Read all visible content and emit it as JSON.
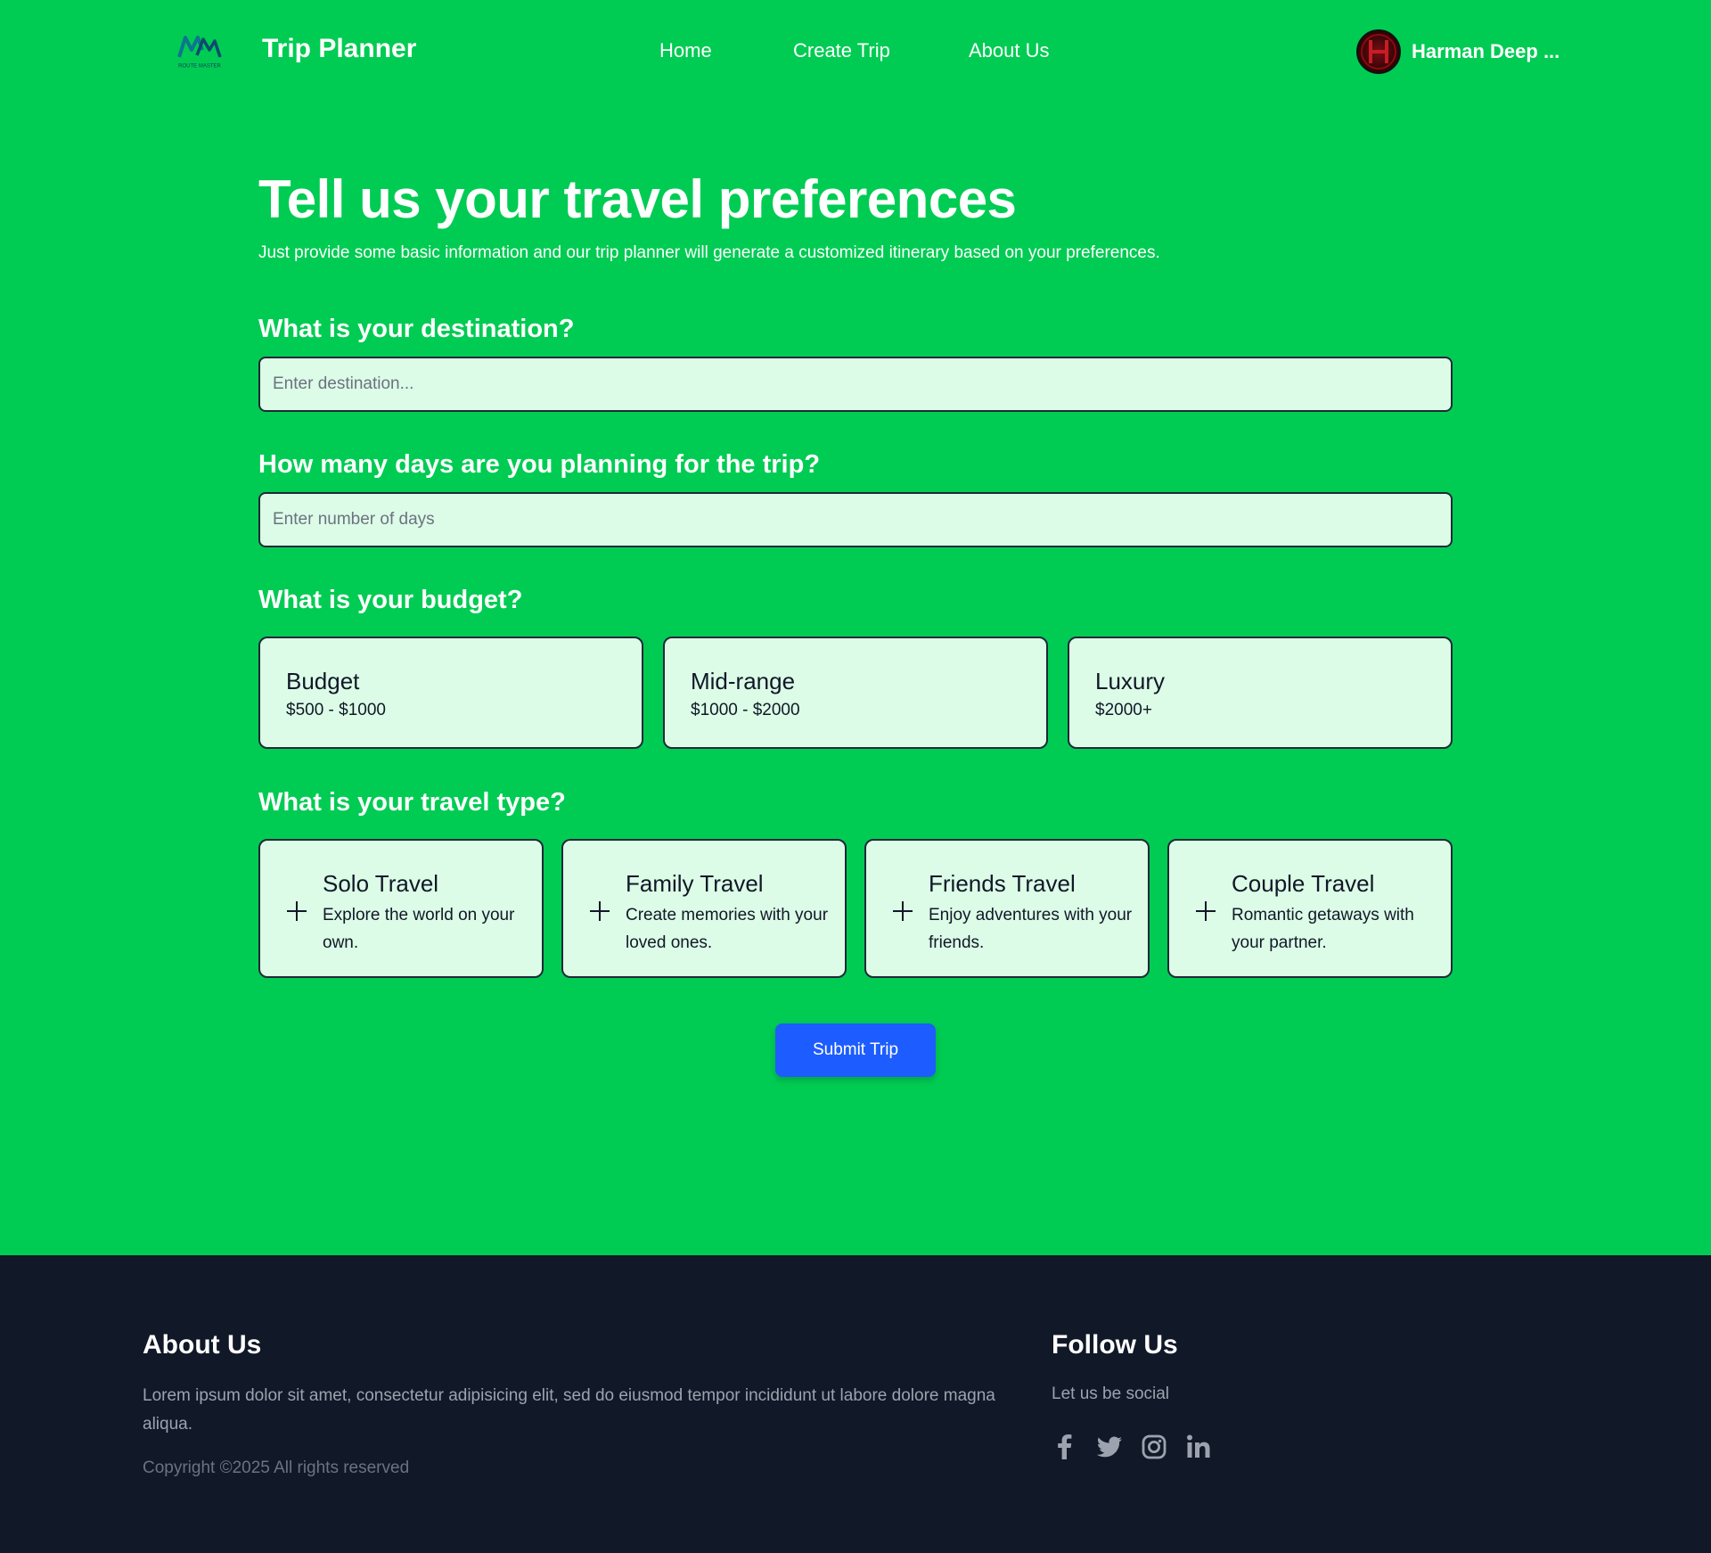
{
  "header": {
    "logo_text": "ROUTE MASTER",
    "brand": "Trip Planner",
    "nav": [
      "Home",
      "Create Trip",
      "About Us"
    ],
    "user_name": "Harman Deep ..."
  },
  "main": {
    "title": "Tell us your travel preferences",
    "subtitle": "Just provide some basic information and our trip planner will generate a customized itinerary based on your preferences.",
    "destination": {
      "question": "What is your destination?",
      "placeholder": "Enter destination..."
    },
    "days": {
      "question": "How many days are you planning for the trip?",
      "placeholder": "Enter number of days"
    },
    "budget": {
      "question": "What is your budget?",
      "options": [
        {
          "title": "Budget",
          "range": "$500 - $1000"
        },
        {
          "title": "Mid-range",
          "range": "$1000 - $2000"
        },
        {
          "title": "Luxury",
          "range": "$2000+"
        }
      ]
    },
    "travel_type": {
      "question": "What is your travel type?",
      "options": [
        {
          "title": "Solo Travel",
          "desc": "Explore the world on your own.",
          "icon": "plus-icon"
        },
        {
          "title": "Family Travel",
          "desc": "Create memories with your loved ones.",
          "icon": "plus-icon"
        },
        {
          "title": "Friends Travel",
          "desc": "Enjoy adventures with your friends.",
          "icon": "plus-icon"
        },
        {
          "title": "Couple Travel",
          "desc": "Romantic getaways with your partner.",
          "icon": "plus-icon"
        }
      ]
    },
    "submit_label": "Submit Trip"
  },
  "footer": {
    "about_heading": "About Us",
    "about_text": "Lorem ipsum dolor sit amet, consectetur adipisicing elit, sed do eiusmod tempor incididunt ut labore dolore magna aliqua.",
    "copyright": "Copyright ©2025 All rights reserved",
    "follow_heading": "Follow Us",
    "follow_text": "Let us be social",
    "social_icons": [
      "facebook-icon",
      "twitter-icon",
      "instagram-icon",
      "linkedin-icon"
    ]
  },
  "colors": {
    "page_background": "#00cc53",
    "card_background": "#dcfce7",
    "submit_button": "#1d5cff",
    "footer_background": "#111827"
  }
}
